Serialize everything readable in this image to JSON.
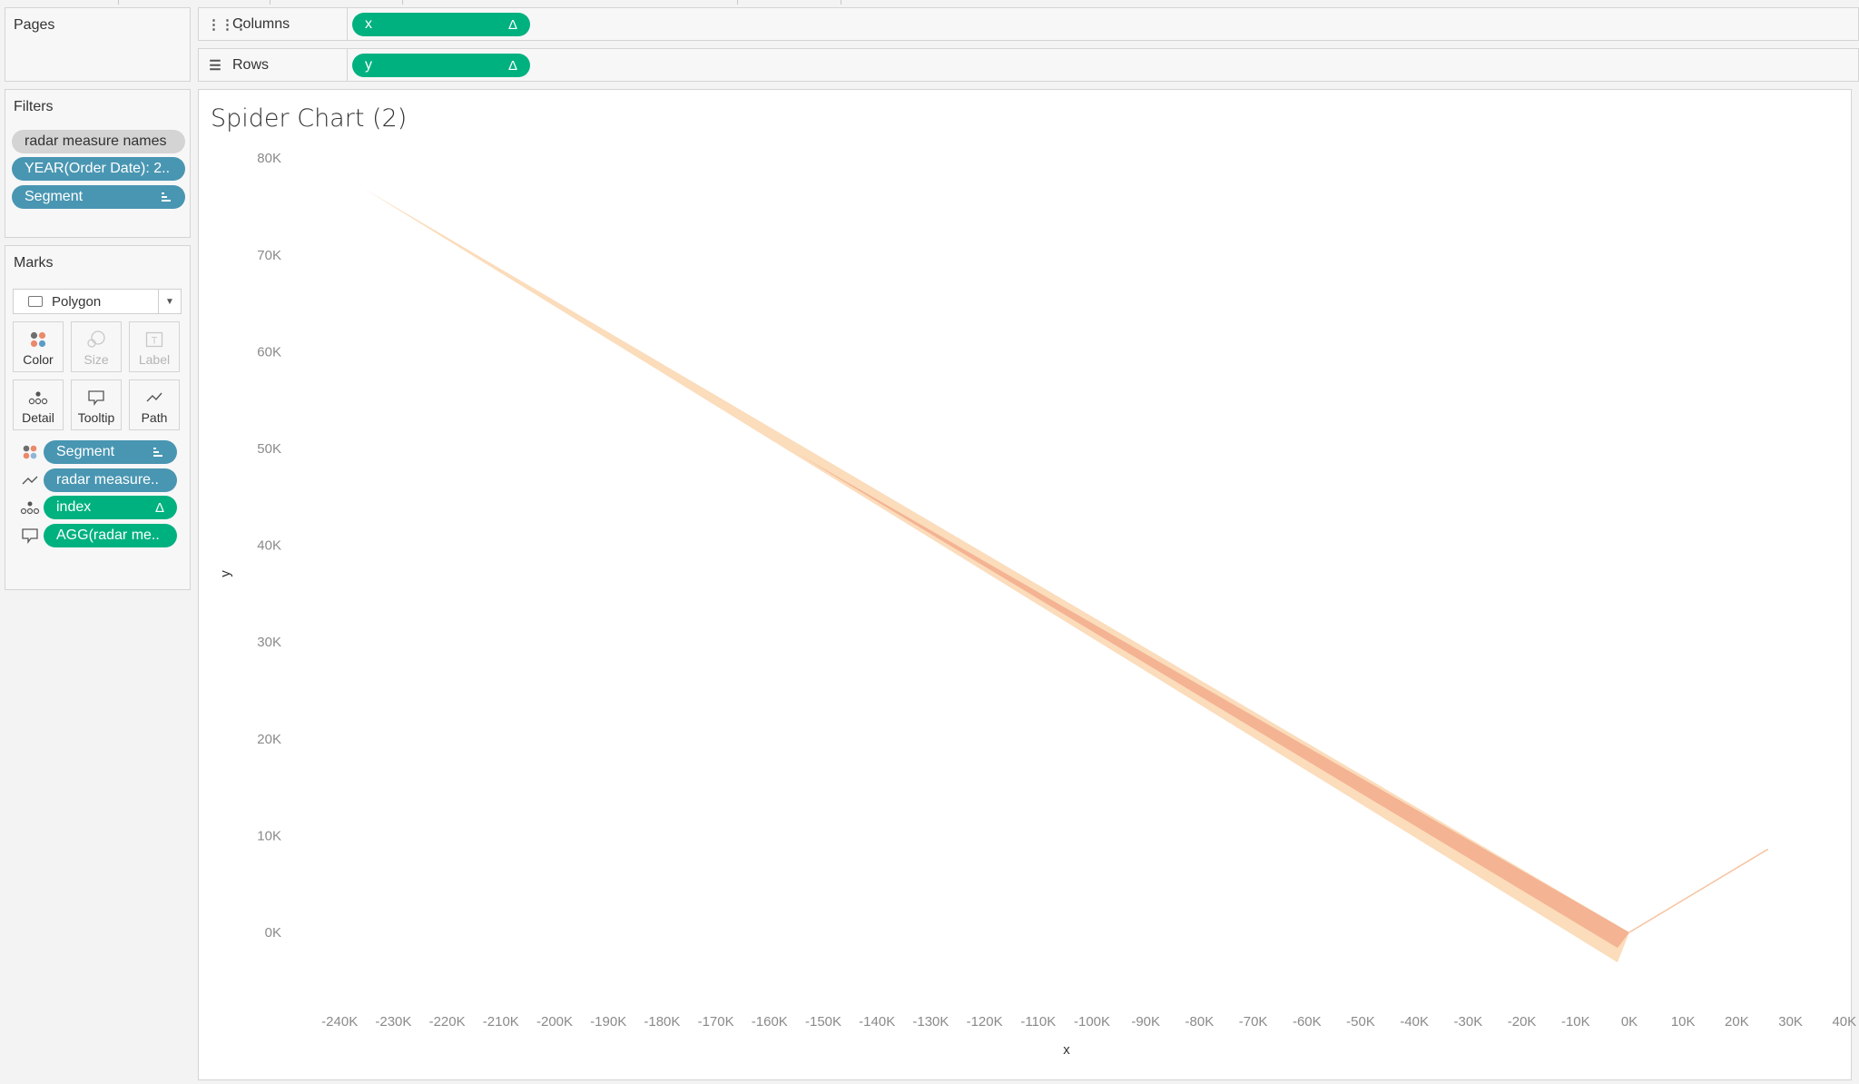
{
  "shelves": {
    "columns": {
      "label": "Columns",
      "icon": "columns-icon",
      "pill": {
        "label": "x",
        "icon": "delta-icon"
      }
    },
    "rows": {
      "label": "Rows",
      "icon": "rows-icon",
      "pill": {
        "label": "y",
        "icon": "delta-icon"
      }
    }
  },
  "pages": {
    "title": "Pages"
  },
  "filters": {
    "title": "Filters",
    "items": [
      {
        "label": "radar measure names",
        "style": "gray"
      },
      {
        "label": "YEAR(Order Date): 2..",
        "style": "blue"
      },
      {
        "label": "Segment",
        "style": "blue",
        "icon": "sort-icon"
      }
    ]
  },
  "marks": {
    "title": "Marks",
    "mark_type": "Polygon",
    "cards": [
      {
        "label": "Color",
        "enabled": true
      },
      {
        "label": "Size",
        "enabled": false
      },
      {
        "label": "Label",
        "enabled": false
      },
      {
        "label": "Detail",
        "enabled": true
      },
      {
        "label": "Tooltip",
        "enabled": true
      },
      {
        "label": "Path",
        "enabled": true
      }
    ],
    "fields": [
      {
        "encoding": "color",
        "label": "Segment",
        "style": "blue",
        "icon": "sort-icon"
      },
      {
        "encoding": "path",
        "label": "radar measure..",
        "style": "blue"
      },
      {
        "encoding": "detail",
        "label": "index",
        "style": "green",
        "icon": "delta-icon"
      },
      {
        "encoding": "tooltip",
        "label": "AGG(radar me..",
        "style": "green"
      }
    ]
  },
  "colors": {
    "green_pill": "#00b180",
    "blue_pill": "#4996b2",
    "series_light": "#fbdcbb",
    "series_dark": "#f4b393"
  },
  "chart_data": {
    "type": "area",
    "title": "Spider Chart (2)",
    "xlabel": "x",
    "ylabel": "y",
    "xlim": [
      -245000,
      42000
    ],
    "ylim": [
      -5000,
      82000
    ],
    "x_ticks": [
      "-240K",
      "-230K",
      "-220K",
      "-210K",
      "-200K",
      "-190K",
      "-180K",
      "-170K",
      "-160K",
      "-150K",
      "-140K",
      "-130K",
      "-120K",
      "-110K",
      "-100K",
      "-90K",
      "-80K",
      "-70K",
      "-60K",
      "-50K",
      "-40K",
      "-30K",
      "-20K",
      "-10K",
      "0K",
      "10K",
      "20K",
      "30K",
      "40K"
    ],
    "x_tick_values": [
      -240000,
      -230000,
      -220000,
      -210000,
      -200000,
      -190000,
      -180000,
      -170000,
      -160000,
      -150000,
      -140000,
      -130000,
      -120000,
      -110000,
      -100000,
      -90000,
      -80000,
      -70000,
      -60000,
      -50000,
      -40000,
      -30000,
      -20000,
      -10000,
      0,
      10000,
      20000,
      30000,
      40000
    ],
    "y_ticks": [
      "0K",
      "10K",
      "20K",
      "30K",
      "40K",
      "50K",
      "60K",
      "70K",
      "80K"
    ],
    "y_tick_values": [
      0,
      10000,
      20000,
      30000,
      40000,
      50000,
      60000,
      70000,
      80000
    ],
    "grid": false,
    "series": [
      {
        "name": "polygon-light",
        "color": "#fbdcbb",
        "points": [
          [
            -235600,
            76900
          ],
          [
            0,
            0
          ],
          [
            -2200,
            -3100
          ]
        ]
      },
      {
        "name": "polygon-dark",
        "color": "#f4b393",
        "points": [
          [
            -154600,
            49400
          ],
          [
            0,
            0
          ],
          [
            -2200,
            -1600
          ]
        ]
      },
      {
        "name": "polygon-line",
        "color": "#f7c3a0",
        "points": [
          [
            0,
            0
          ],
          [
            25800,
            8600
          ]
        ]
      }
    ]
  }
}
